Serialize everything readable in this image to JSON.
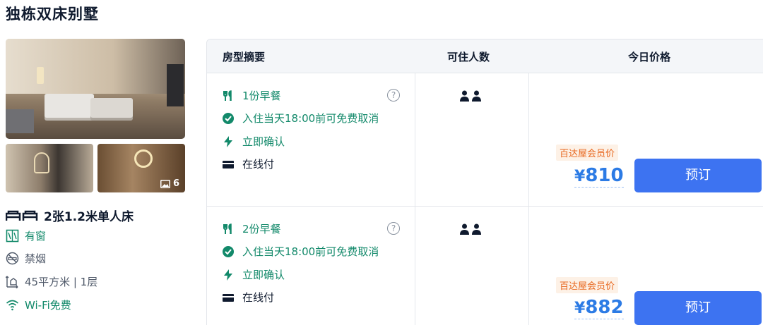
{
  "room": {
    "title": "独栋双床别墅",
    "photo_count": "6",
    "bed": "2张1.2米单人床",
    "features": [
      {
        "icon": "window-icon",
        "text": "有窗"
      },
      {
        "icon": "no-smoking-icon",
        "text": "禁烟"
      },
      {
        "icon": "area-icon",
        "text": "45平方米 | 1层"
      },
      {
        "icon": "wifi-icon",
        "text": "Wi-Fi免费"
      }
    ]
  },
  "table": {
    "headers": {
      "summary": "房型摘要",
      "guests": "可住人数",
      "price": "今日价格"
    },
    "rows": [
      {
        "breakfast": "1份早餐",
        "cancel": "入住当天18:00前可免费取消",
        "confirm": "立即确认",
        "payment": "在线付",
        "help": "?",
        "guests": 2,
        "member_tag": "百达屋会员价",
        "currency": "¥",
        "price": "810",
        "book_label": "预订"
      },
      {
        "breakfast": "2份早餐",
        "cancel": "入住当天18:00前可免费取消",
        "confirm": "立即确认",
        "payment": "在线付",
        "help": "?",
        "guests": 2,
        "member_tag": "百达屋会员价",
        "currency": "¥",
        "price": "882",
        "book_label": "预订"
      }
    ]
  },
  "colors": {
    "accent_green": "#12896a",
    "price_blue": "#2c7be5",
    "button_blue": "#3d73f1",
    "member_orange": "#e8671e"
  }
}
